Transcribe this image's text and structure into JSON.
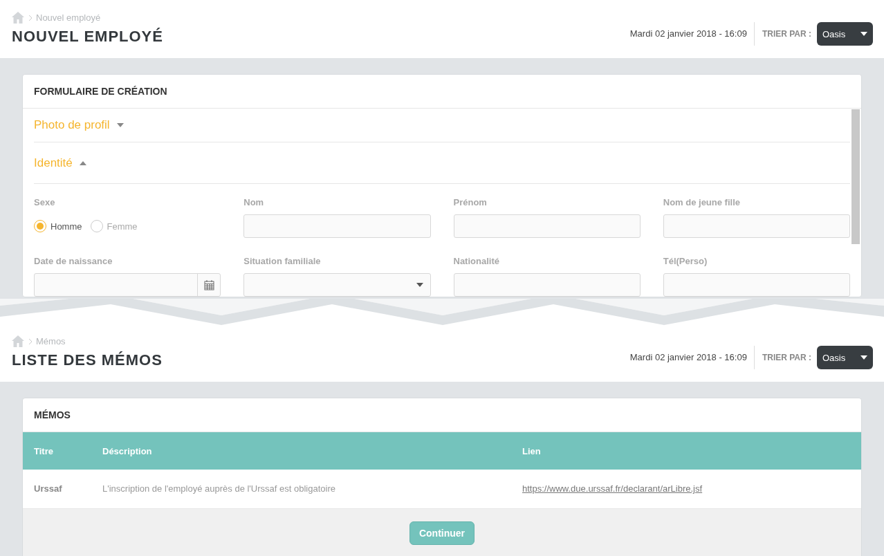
{
  "employee_screen": {
    "header": {
      "breadcrumb": "Nouvel employé",
      "title": "NOUVEL EMPLOYÉ",
      "datetime": "Mardi 02 janvier 2018 - 16:09",
      "sort_label": "TRIER PAR :",
      "sort_value": "Oasis"
    },
    "card": {
      "title": "FORMULAIRE DE CRÉATION",
      "sections": [
        {
          "title": "Photo de profil",
          "expanded": false
        },
        {
          "title": "Identité",
          "expanded": true,
          "fields": [
            {
              "kind": "radio",
              "label": "Sexe",
              "options": [
                {
                  "label": "Homme",
                  "selected": true
                },
                {
                  "label": "Femme",
                  "selected": false
                }
              ]
            },
            {
              "kind": "text",
              "label": "Nom"
            },
            {
              "kind": "text",
              "label": "Prénom"
            },
            {
              "kind": "text",
              "label": "Nom de jeune fille"
            },
            {
              "kind": "date",
              "label": "Date de naissance"
            },
            {
              "kind": "select",
              "label": "Situation familiale"
            },
            {
              "kind": "text",
              "label": "Nationalité"
            },
            {
              "kind": "text",
              "label": "Tél(Perso)"
            }
          ]
        }
      ]
    }
  },
  "memo_screen": {
    "header": {
      "breadcrumb": "Mémos",
      "title": "LISTE DES MÉMOS",
      "datetime": "Mardi 02 janvier 2018 - 16:09",
      "sort_label": "TRIER PAR :",
      "sort_value": "Oasis"
    },
    "card": {
      "title": "MÉMOS",
      "table": {
        "columns": [
          "Titre",
          "Déscription",
          "Lien"
        ],
        "rows": [
          {
            "cells": [
              {
                "kind": "title",
                "text": "Urssaf"
              },
              {
                "kind": "text",
                "text": "L'inscription de l'employé auprès de l'Urssaf est obligatoire"
              },
              {
                "kind": "link",
                "text": "https://www.due.urssaf.fr/declarant/arLibre.jsf"
              }
            ]
          }
        ]
      },
      "button": "Continuer"
    }
  }
}
